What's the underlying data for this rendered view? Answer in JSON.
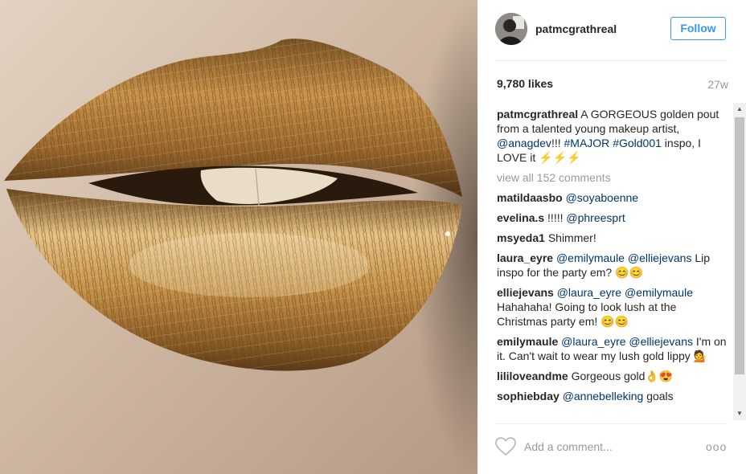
{
  "post": {
    "username": "patmcgrathreal",
    "follow_label": "Follow",
    "likes": "9,780 likes",
    "age": "27w"
  },
  "caption": {
    "username": "patmcgrathreal",
    "text1": " A GORGEOUS golden pout from a talented young makeup artist, ",
    "mention": "@anagdev",
    "text2": "!!! ",
    "tag1": "#MAJOR",
    "tag2": "#Gold001",
    "text3": " inspo, I LOVE it ⚡⚡⚡"
  },
  "view_all": "view all 152 comments",
  "comments": [
    {
      "user": "matildaasbo",
      "mentions": "@soyaboenne",
      "text": ""
    },
    {
      "user": "evelina.s",
      "pre": " !!!!! ",
      "mentions": "@phreesprt",
      "text": ""
    },
    {
      "user": "msyeda1",
      "text": " Shimmer!"
    },
    {
      "user": "laura_eyre",
      "mentions": "@emilymaule @elliejevans",
      "text": " Lip inspo for the party em? 😊😊"
    },
    {
      "user": "elliejevans",
      "mentions": "@laura_eyre @emilymaule",
      "text": " Hahahaha! Going to look lush at the Christmas party em! 😊😊"
    },
    {
      "user": "emilymaule",
      "mentions": "@laura_eyre @elliejevans",
      "text": " I'm on it. Can't wait to wear my lush gold lippy 💁"
    },
    {
      "user": "lililoveandme",
      "text": " Gorgeous gold👌😍"
    },
    {
      "user": "sophiebday",
      "mentions": "@annebelleking",
      "text": " goals"
    }
  ],
  "add_comment_placeholder": "Add a comment...",
  "more_label": "ooo",
  "icons": {
    "like": "heart-outline-icon",
    "more": "more-options-icon",
    "scroll_up": "scroll-up-arrow-icon",
    "scroll_down": "scroll-down-arrow-icon"
  },
  "colors": {
    "accent": "#3897f0",
    "mention": "#003569",
    "muted": "#999999",
    "gold": "#b8863a"
  }
}
